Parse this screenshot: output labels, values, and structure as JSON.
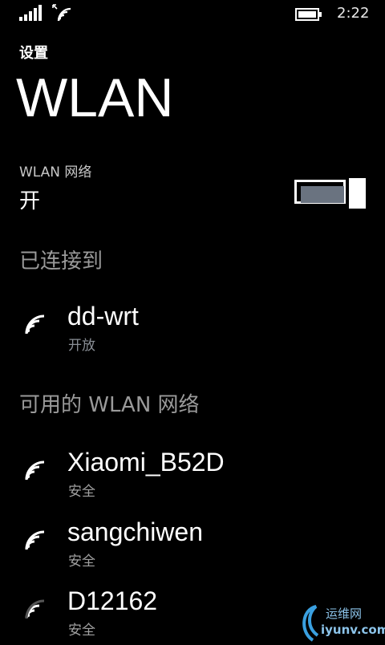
{
  "status_bar": {
    "time": "2:22",
    "signal_icon": "signal-bars-icon",
    "wifi_icon": "wifi-status-icon",
    "battery_icon": "battery-icon"
  },
  "app_title": "设置",
  "page_title": "WLAN",
  "wlan_toggle": {
    "label": "WLAN 网络",
    "state_label": "开",
    "on": true,
    "fill_color": "#6a7380"
  },
  "connected_section": {
    "header": "已连接到",
    "networks": [
      {
        "name": "dd-wrt",
        "status": "开放",
        "status_color": "#8a8f96",
        "icon": "wifi-signal-icon"
      }
    ]
  },
  "available_section": {
    "header": "可用的 WLAN 网络",
    "networks": [
      {
        "name": "Xiaomi_B52D",
        "status": "安全",
        "icon": "wifi-signal-icon"
      },
      {
        "name": "sangchiwen",
        "status": "安全",
        "icon": "wifi-signal-icon"
      },
      {
        "name": "D12162",
        "status": "安全",
        "icon": "wifi-signal-weak-icon"
      }
    ]
  },
  "watermark": {
    "text": "运维网",
    "domain": "iyunv.com"
  },
  "colors": {
    "background": "#000000",
    "text": "#ffffff",
    "secondary_text": "#9a9a9a",
    "subtext": "#a0a0a0"
  }
}
